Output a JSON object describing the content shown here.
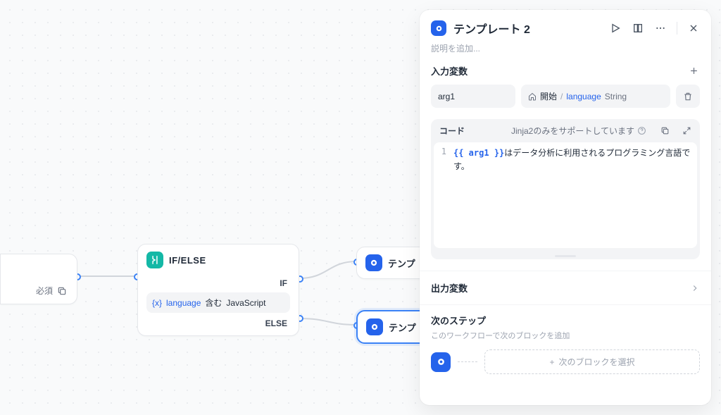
{
  "canvas": {
    "start_node": {
      "required_label": "必須"
    },
    "ifelse_node": {
      "title": "IF/ELSE",
      "if_label": "IF",
      "condition": {
        "variable": "language",
        "operator": "含む",
        "value": "JavaScript"
      },
      "else_label": "ELSE"
    },
    "template_node_1": "テンプ",
    "template_node_2": "テンプ"
  },
  "panel": {
    "title": "テンプレート 2",
    "description_placeholder": "説明を追加...",
    "input_vars": {
      "heading": "入力変数",
      "name": "arg1",
      "source_node": "開始",
      "source_var": "language",
      "source_type": "String"
    },
    "code": {
      "heading": "コード",
      "support_text": "Jinja2のみをサポートしています",
      "line_number": "1",
      "jinja_open": "{{",
      "jinja_var": " arg1 ",
      "jinja_close": "}}",
      "suffix_text": "はデータ分析に利用されるプログラミング言語です。"
    },
    "output_vars_heading": "出力変数",
    "next_steps": {
      "heading": "次のステップ",
      "description": "このワークフローで次のブロックを追加",
      "placeholder": "次のブロックを選択"
    }
  }
}
